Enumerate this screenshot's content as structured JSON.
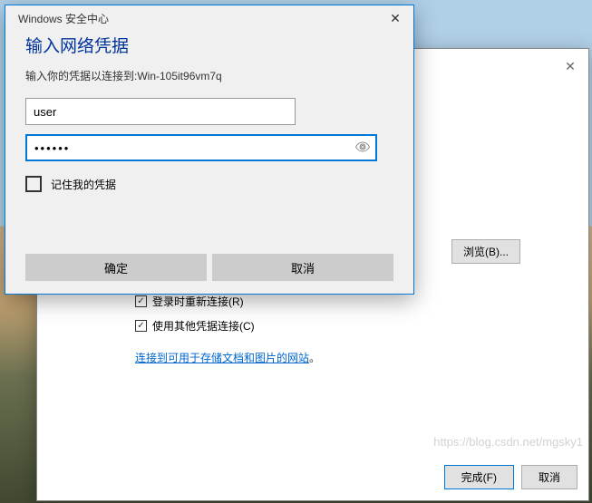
{
  "credentialDialog": {
    "title": "Windows 安全中心",
    "heading": "输入网络凭据",
    "subtext": "输入你的凭据以连接到:Win-105it96vm7q",
    "usernameValue": "user",
    "passwordValue": "••••••",
    "rememberLabel": "记住我的凭据",
    "okLabel": "确定",
    "cancelLabel": "取消"
  },
  "backWindow": {
    "browseLabel": "浏览(B)...",
    "checkbox1Label": "登录时重新连接(R)",
    "checkbox2Label": "使用其他凭据连接(C)",
    "linkText": "连接到可用于存储文档和图片的网站",
    "period": "。",
    "finishLabel": "完成(F)",
    "cancelLabel": "取消"
  },
  "watermark": "https://blog.csdn.net/mgsky1"
}
